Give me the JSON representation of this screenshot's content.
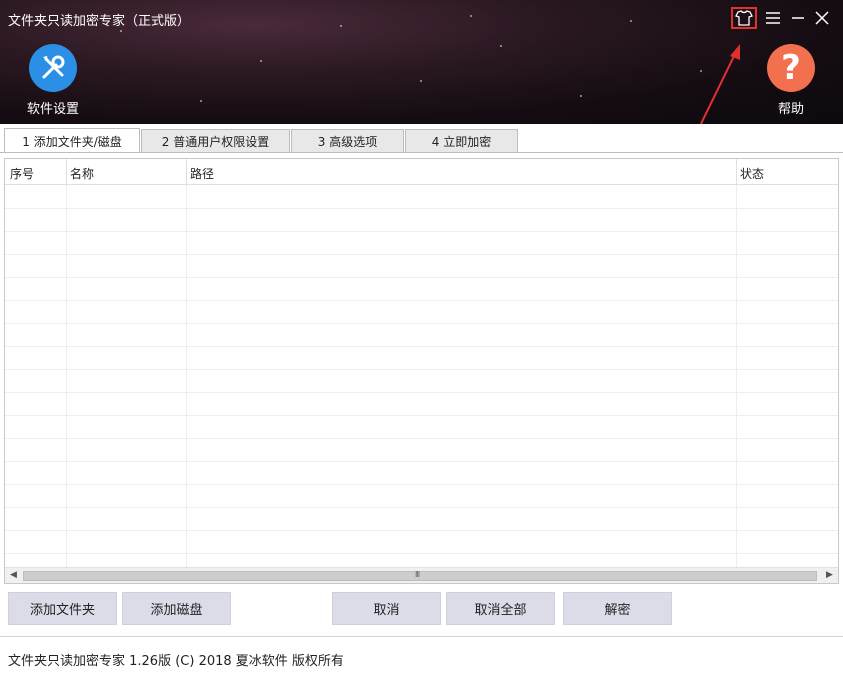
{
  "window": {
    "title": "文件夹只读加密专家（正式版）"
  },
  "title_controls": {
    "skin_icon": "tshirt-icon",
    "menu_icon": "hamburger-menu-icon",
    "minimize_icon": "minimize-icon",
    "close_icon": "close-icon"
  },
  "toolbar": {
    "settings_label": "软件设置",
    "help_label": "帮助",
    "help_glyph": "?"
  },
  "tabs": [
    {
      "label": "1 添加文件夹/磁盘",
      "active": true
    },
    {
      "label": "2 普通用户权限设置",
      "active": false
    },
    {
      "label": "3 高级选项",
      "active": false
    },
    {
      "label": "4 立即加密",
      "active": false
    }
  ],
  "table": {
    "columns": [
      "序号",
      "名称",
      "路径",
      "状态"
    ],
    "rows": []
  },
  "scrollbar": {
    "left_arrow": "◀",
    "right_arrow": "▶",
    "grip": "III"
  },
  "buttons": {
    "add_folder": "添加文件夹",
    "add_disk": "添加磁盘",
    "cancel": "取消",
    "cancel_all": "取消全部",
    "decrypt": "解密"
  },
  "footer": {
    "text": "文件夹只读加密专家  1.26版 (C) 2018 夏冰软件 版权所有"
  },
  "colors": {
    "highlight": "#e03030",
    "settings_icon_bg": "#2b8fe6",
    "help_icon_bg": "#f3704e",
    "button_bg": "#dcdce8"
  }
}
